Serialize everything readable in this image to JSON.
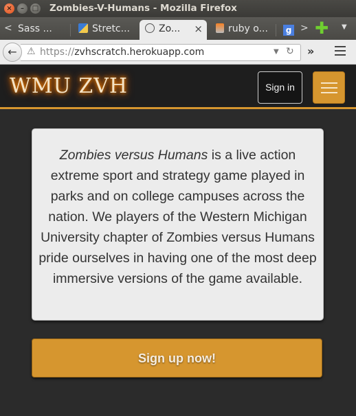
{
  "window": {
    "title": "Zombies-V-Humans - Mozilla Firefox",
    "close_glyph": "×",
    "min_glyph": "–",
    "max_glyph": "□"
  },
  "tabs": {
    "scroll_left_glyph": "<",
    "scroll_right_glyph": ">",
    "items": [
      {
        "label": "Sass ...",
        "icon": "sass-icon",
        "active": false
      },
      {
        "label": "Stretc...",
        "icon": "page-icon",
        "active": false
      },
      {
        "label": "Zo...",
        "icon": "zombie-icon",
        "active": true,
        "close_glyph": "×"
      },
      {
        "label": "ruby o...",
        "icon": "stackoverflow-icon",
        "active": false
      },
      {
        "label": "g",
        "icon": "google-icon",
        "active": false
      }
    ],
    "new_tab_glyph": "✚",
    "menu_glyph": "▼"
  },
  "navbar": {
    "back_glyph": "←",
    "url_scheme": "https://",
    "url_host": "zvhscratch.herokuapp.com",
    "warning_glyph": "⚠",
    "dropdown_glyph": "▼",
    "reload_glyph": "↻",
    "overflow_glyph": "»"
  },
  "site": {
    "brand": "WMU ZVH",
    "signin_label": "Sign in",
    "accent_color": "#d6962f",
    "intro_em": "Zombies versus Humans",
    "intro_rest": " is a live action extreme sport and strategy game played in parks and on college campuses across the nation. We players of the Western Michigan University chapter of Zombies versus Humans pride ourselves in having one of the most deep immersive versions of the game available.",
    "signup_label": "Sign up now!"
  }
}
